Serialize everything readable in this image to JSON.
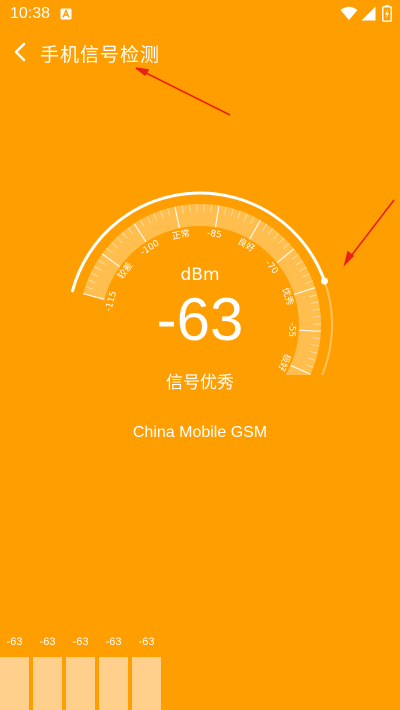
{
  "status_bar": {
    "time": "10:38",
    "icons": [
      "a-notification-icon",
      "wifi-icon",
      "signal-icon",
      "battery-charging-icon"
    ]
  },
  "app_bar": {
    "title": "手机信号检测",
    "back_icon": "chevron-left-icon"
  },
  "gauge": {
    "unit": "dBm",
    "value": "-63",
    "quality": "信号优秀",
    "level_dbm": -63,
    "range_dbm": [
      -115,
      -40
    ],
    "ticks": [
      "-115",
      "较差",
      "-100",
      "正常",
      "-85",
      "良好",
      "-70",
      "优秀",
      "-55",
      "极好",
      "-40"
    ]
  },
  "carrier": "China Mobile GSM",
  "history": {
    "values": [
      "-63",
      "-63",
      "-63",
      "-63",
      "-63"
    ]
  },
  "colors": {
    "background": "#FF9E00",
    "annotation_arrow": "#E8201A",
    "history_bar": "#FFCF8C"
  }
}
